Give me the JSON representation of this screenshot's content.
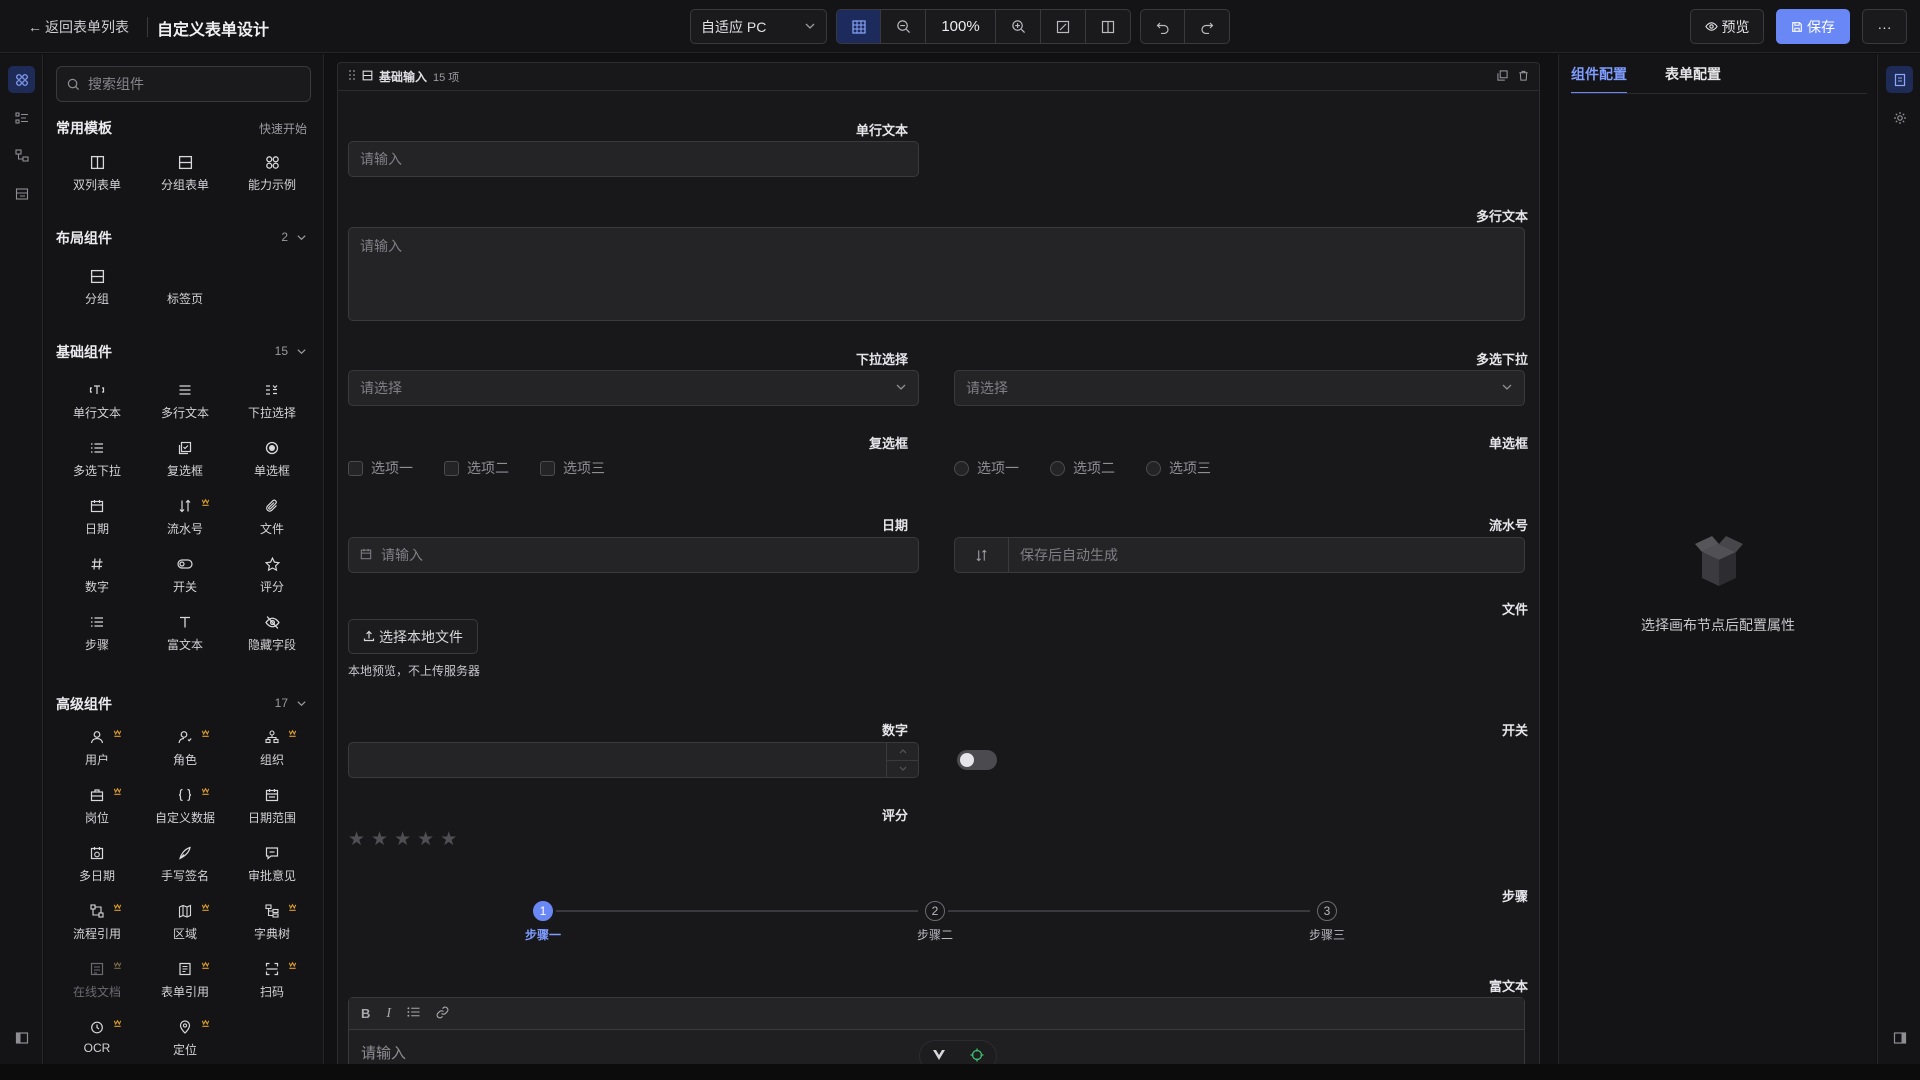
{
  "header": {
    "back_label": "返回表单列表",
    "title": "自定义表单设计",
    "device": "自适应 PC",
    "zoom": "100%",
    "preview_label": "预览",
    "save_label": "保存",
    "more_label": "···"
  },
  "components": {
    "search_placeholder": "搜索组件",
    "templates": {
      "title": "常用模板",
      "action": "快速开始",
      "items": [
        "双列表单",
        "分组表单",
        "能力示例"
      ]
    },
    "layout": {
      "title": "布局组件",
      "count": "2",
      "items": [
        "分组",
        "标签页"
      ]
    },
    "basic": {
      "title": "基础组件",
      "count": "15",
      "items": [
        "单行文本",
        "多行文本",
        "下拉选择",
        "多选下拉",
        "复选框",
        "单选框",
        "日期",
        "流水号",
        "文件",
        "数字",
        "开关",
        "评分",
        "步骤",
        "富文本",
        "隐藏字段"
      ]
    },
    "advanced": {
      "title": "高级组件",
      "count": "17",
      "items": [
        "用户",
        "角色",
        "组织",
        "岗位",
        "自定义数据",
        "日期范围",
        "多日期",
        "手写签名",
        "审批意见",
        "流程引用",
        "区域",
        "字典树",
        "在线文档",
        "表单引用",
        "扫码",
        "OCR",
        "定位"
      ]
    }
  },
  "canvas": {
    "group_title": "基础输入",
    "group_count": "15 项",
    "fields": {
      "single_text": {
        "label": "单行文本",
        "placeholder": "请输入"
      },
      "multi_text": {
        "label": "多行文本",
        "placeholder": "请输入"
      },
      "select": {
        "label": "下拉选择",
        "placeholder": "请选择"
      },
      "multi_select": {
        "label": "多选下拉",
        "placeholder": "请选择"
      },
      "checkbox": {
        "label": "复选框",
        "options": [
          "选项一",
          "选项二",
          "选项三"
        ]
      },
      "radio": {
        "label": "单选框",
        "options": [
          "选项一",
          "选项二",
          "选项三"
        ]
      },
      "date": {
        "label": "日期",
        "placeholder": "请输入"
      },
      "serial": {
        "label": "流水号",
        "placeholder": "保存后自动生成"
      },
      "file": {
        "label": "文件",
        "button": "选择本地文件",
        "hint": "本地预览，不上传服务器"
      },
      "number": {
        "label": "数字"
      },
      "switch": {
        "label": "开关"
      },
      "rate": {
        "label": "评分",
        "stars": 5,
        "value": 0
      },
      "steps": {
        "label": "步骤",
        "items": [
          "步骤一",
          "步骤二",
          "步骤三"
        ],
        "numbers": [
          "1",
          "2",
          "3"
        ],
        "current": 1
      },
      "rich_text": {
        "label": "富文本",
        "placeholder": "请输入"
      }
    }
  },
  "config": {
    "tabs": [
      "组件配置",
      "表单配置"
    ],
    "empty_text": "选择画布节点后配置属性"
  },
  "colors": {
    "accent": "#6a88f5",
    "pro_badge": "#d99a2b"
  }
}
